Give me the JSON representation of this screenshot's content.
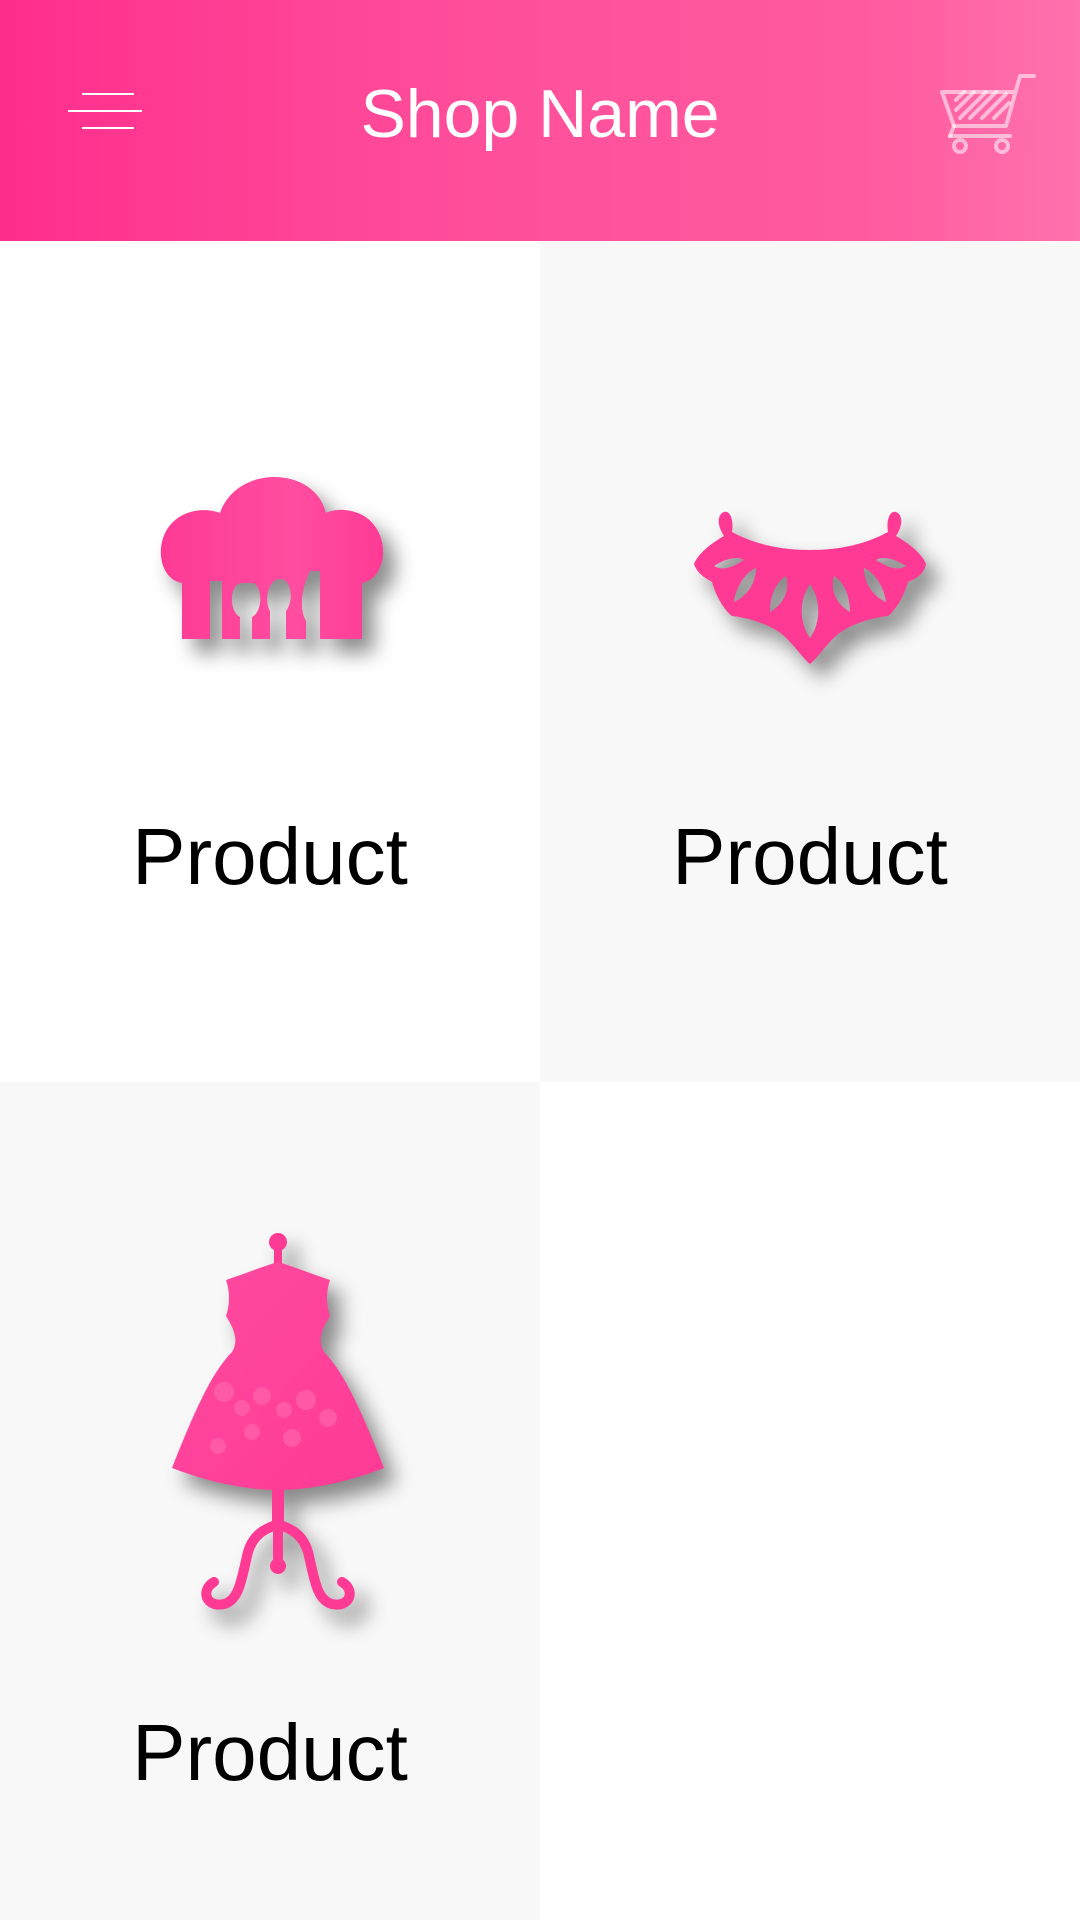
{
  "header": {
    "title": "Shop Name",
    "menu_icon": "hamburger-menu-icon",
    "cart_icon": "shopping-cart-icon",
    "background_gradient": [
      "#ff2d8d",
      "#ff72ac"
    ],
    "text_color": "#ffffff"
  },
  "products": [
    {
      "label": "Product",
      "icon": "chef-hat-cutlery-icon"
    },
    {
      "label": "Product",
      "icon": "necklace-icon"
    },
    {
      "label": "Product",
      "icon": "dress-mannequin-icon"
    }
  ],
  "colors": {
    "accent": "#ff3c96",
    "cell_light": "#ffffff",
    "cell_gray": "#f8f8f8"
  }
}
